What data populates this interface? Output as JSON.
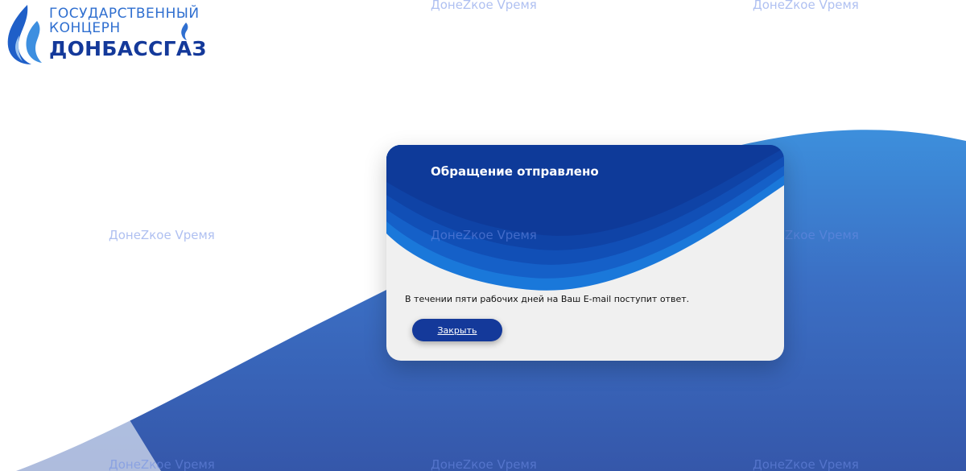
{
  "logo": {
    "line1": "ГОСУДАРСТВЕННЫЙ",
    "line2": "КОНЦЕРН",
    "line3": "ДОНБАССГАЗ"
  },
  "watermark": {
    "text": "ДонеZкое Vремя"
  },
  "modal": {
    "title": "Обращение отправлено",
    "message": "В течении пяти рабочих дней на Ваш E-mail поступит ответ.",
    "close_label": "Закрыть"
  },
  "colors": {
    "brand_dark_blue": "#14399a",
    "brand_mid_blue": "#1d6ad6",
    "brand_light_blue": "#2f6fd0",
    "modal_background": "#f0f0f0",
    "watermark": "#8a9ee6"
  },
  "icons": {
    "logo_mark": "blue-flame-icon"
  }
}
